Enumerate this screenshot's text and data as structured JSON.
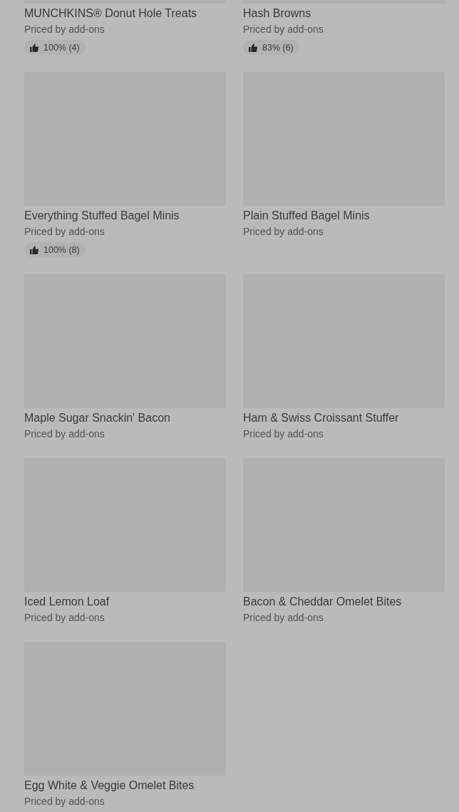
{
  "items": [
    {
      "name": "MUNCHKINS® Donut Hole Treats",
      "price": "Priced by add-ons",
      "rating": "100% (4)"
    },
    {
      "name": "Hash Browns",
      "price": "Priced by add-ons",
      "rating": "83% (6)"
    },
    {
      "name": "Everything Stuffed Bagel Minis",
      "price": "Priced by add-ons",
      "rating": "100% (8)"
    },
    {
      "name": "Plain Stuffed Bagel Minis",
      "price": "Priced by add-ons"
    },
    {
      "name": "Maple Sugar Snackin' Bacon",
      "price": "Priced by add-ons"
    },
    {
      "name": "Ham & Swiss Croissant Stuffer",
      "price": "Priced by add-ons"
    },
    {
      "name": "Iced Lemon Loaf",
      "price": "Priced by add-ons"
    },
    {
      "name": "Bacon & Cheddar Omelet Bites",
      "price": "Priced by add-ons"
    },
    {
      "name": "Egg White & Veggie Omelet Bites",
      "price": "Priced by add-ons"
    }
  ]
}
